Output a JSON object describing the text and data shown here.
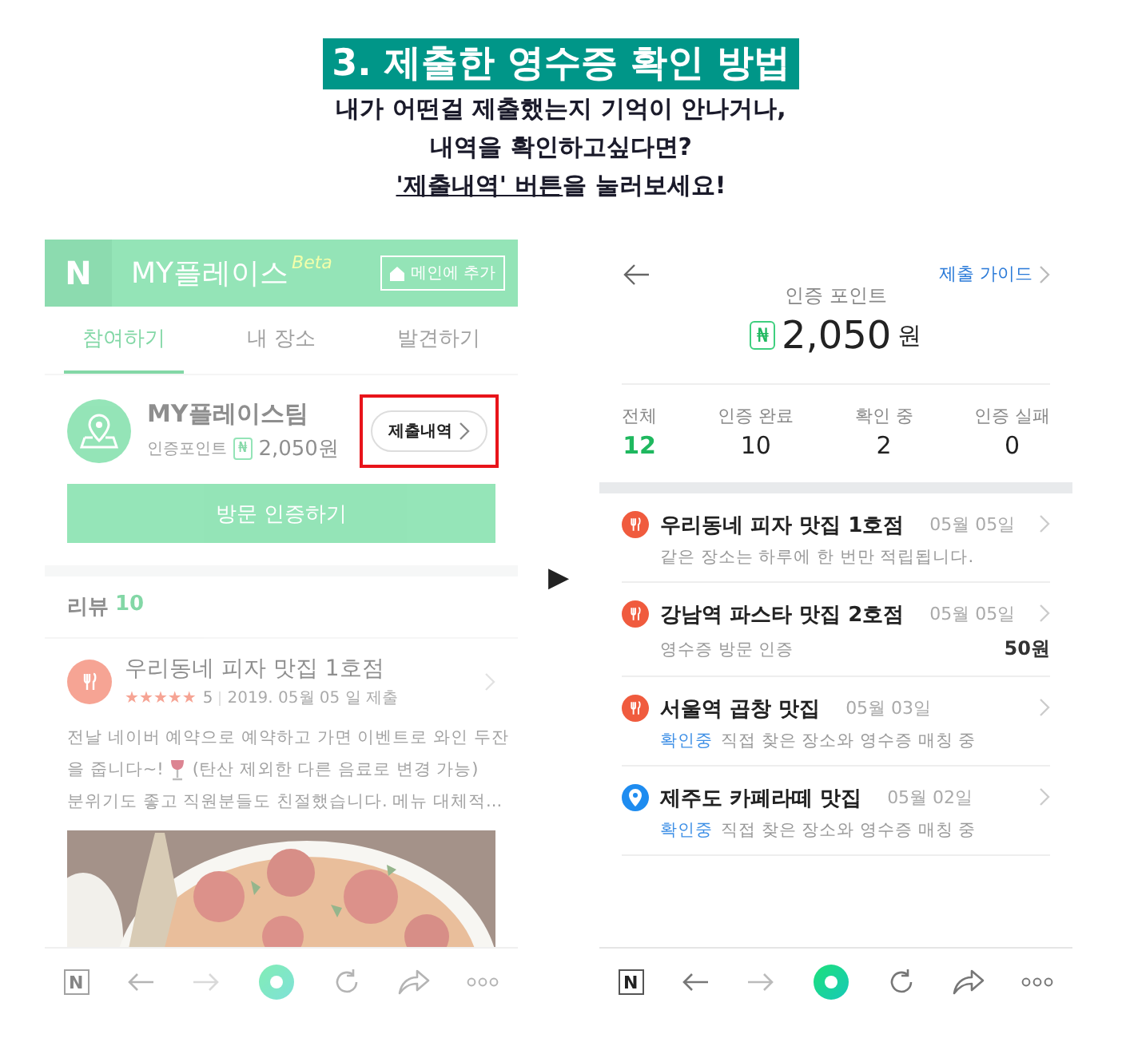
{
  "header": {
    "title": "3. 제출한 영수증 확인 방법",
    "lines": [
      "내가 어떤걸 제출했는지 기억이 안나거나,",
      "내역을 확인하고싶다면?"
    ],
    "instruction": {
      "underlined": "'제출내역' 버튼",
      "rest": "을 눌러보세요!"
    }
  },
  "left_screen": {
    "app_bar": {
      "logo": "N",
      "title": "MY플레이스",
      "badge": "Beta",
      "add_button": "메인에 추가"
    },
    "tabs": [
      {
        "label": "참여하기",
        "selected": true
      },
      {
        "label": "내 장소",
        "selected": false
      },
      {
        "label": "발견하기",
        "selected": false
      }
    ],
    "profile": {
      "name": "MY플레이스팀",
      "points_label": "인증포인트",
      "currency": "₦",
      "points": "2,050",
      "unit": "원",
      "history_button": "제출내역",
      "highlighted": true
    },
    "visit_button": "방문 인증하기",
    "reviews": {
      "label": "리뷰",
      "count": "10"
    },
    "review": {
      "title": "우리동네 피자 맛집 1호점",
      "stars": 5,
      "rating": "5",
      "date": "2019. 05월 05 일 제출",
      "body_lines": [
        [
          {
            "kind": "text",
            "text": "전날 네이버 예약으로 예약하고 가면 이벤트로 와인 두잔"
          }
        ],
        [
          {
            "kind": "text",
            "text": "을 줍니다~!"
          },
          {
            "kind": "wine"
          },
          {
            "kind": "text",
            "text": "(탄산 제외한 다른 음료로 변경 가능)"
          }
        ],
        [
          {
            "kind": "text",
            "text": "분위기도 좋고 직원분들도 친절했습니다. 메뉴 대체적..."
          }
        ]
      ],
      "photo": {
        "kind": "picture"
      }
    },
    "nav_logo": "N"
  },
  "arrow": "▶",
  "right_screen": {
    "guide_link": "제출 가이드",
    "points_label": "인증 포인트",
    "currency": "₦",
    "points": "2,050",
    "unit": "원",
    "stats": [
      {
        "label": "전체",
        "value": "12",
        "selected": true
      },
      {
        "label": "인증 완료",
        "value": "10",
        "selected": false
      },
      {
        "label": "확인 중",
        "value": "2",
        "selected": false
      },
      {
        "label": "인증 실패",
        "value": "0",
        "selected": false
      }
    ],
    "entries": [
      {
        "kind": "restaurant",
        "title": "우리동네 피자 맛집 1호점",
        "date": "05월 05일",
        "note": "같은 장소는 하루에 한 번만 적립됩니다."
      },
      {
        "kind": "restaurant",
        "title": "강남역 파스타 맛집 2호점",
        "date": "05월 05일",
        "note": "영수증 방문 인증",
        "reward": "50원"
      },
      {
        "kind": "restaurant",
        "title": "서울역 곱창 맛집",
        "date": "05월 03일",
        "status": "확인중",
        "note": "직접 찾은 장소와 영수증 매칭 중"
      },
      {
        "kind": "place",
        "title": "제주도 카페라떼 맛집",
        "date": "05월 02일",
        "status": "확인중",
        "note": "직접 찾은 장소와 영수증 매칭 중"
      }
    ],
    "nav_logo": "N"
  }
}
